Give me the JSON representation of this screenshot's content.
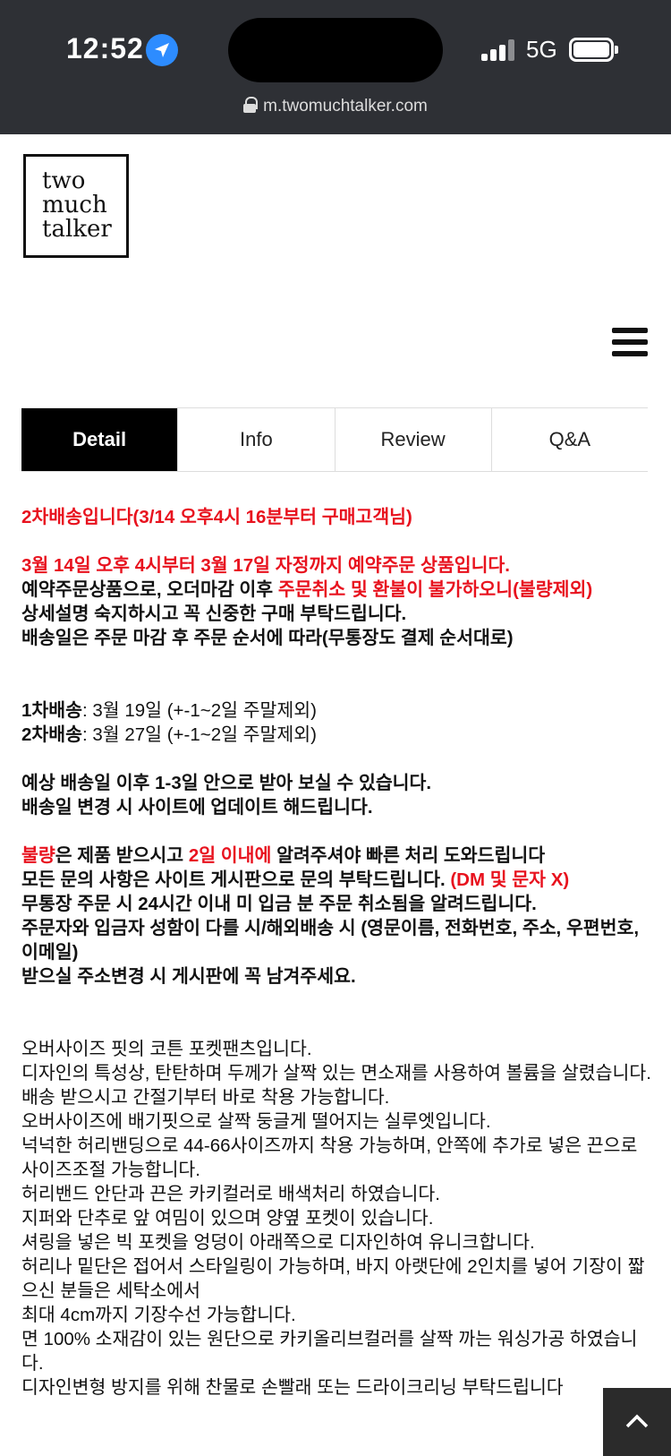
{
  "status_bar": {
    "time": "12:52",
    "network": "5G"
  },
  "browser": {
    "url": "m.twomuchtalker.com"
  },
  "logo": {
    "lines": [
      "two",
      "much",
      "talker"
    ]
  },
  "tabs": [
    {
      "label": "Detail",
      "active": true
    },
    {
      "label": "Info",
      "active": false
    },
    {
      "label": "Review",
      "active": false
    },
    {
      "label": "Q&A",
      "active": false
    }
  ],
  "notice": {
    "heading": "2차배송입니다(3/14 오후4시 16분부터 구매고객님)",
    "preorder_period": "3월 14일 오후 4시부터 3월 17일 자정까지 예약주문 상품입니다.",
    "cancel_prefix": "예약주문상품으로, 오더마감 이후 ",
    "cancel_red": "주문취소 및 환불이 불가하오니(불량제외)",
    "read_carefully": "상세설명 숙지하시고 꼭 신중한 구매 부탁드립니다.",
    "ship_order": "배송일은 주문 마감 후 주문 순서에 따라(무통장도 결제 순서대로)",
    "first_ship_label": "1차배송",
    "first_ship_value": ": 3월 19일 (+-1~2일 주말제외)",
    "second_ship_label": "2차배송",
    "second_ship_value": ": 3월 27일 (+-1~2일 주말제외)",
    "receive_window": "예상 배송일 이후 1-3일 안으로 받아 보실 수 있습니다.",
    "site_update": "배송일 변경 시 사이트에 업데이트 해드립니다.",
    "defect_red1": "불량",
    "defect_mid1": "은 제품 받으시고 ",
    "defect_red2": "2일 이내에",
    "defect_tail": " 알려주셔야 빠른 처리 도와드립니다",
    "inquiry_prefix": "모든 문의 사항은 사이트 게시판으로 문의 부탁드립니다. ",
    "inquiry_red": "(DM 및 문자 X)",
    "bank_cancel": "무통장 주문 시 24시간 이내 미 입금 분 주문 취소됨을 알려드립니다.",
    "overseas": "주문자와 입금자 성함이 다를 시/해외배송 시 (영문이름, 전화번호, 주소, 우편번호, 이메일)",
    "address_change": "받으실 주소변경 시 게시판에 꼭 남겨주세요."
  },
  "description": [
    "오버사이즈 핏의 코튼 포켓팬츠입니다.",
    "디자인의 특성상, 탄탄하며 두께가 살짝 있는 면소재를 사용하여 볼륨을 살렸습니다.",
    "배송 받으시고 간절기부터 바로 착용 가능합니다.",
    "오버사이즈에 배기핏으로 살짝 둥글게 떨어지는 실루엣입니다.",
    "넉넉한 허리밴딩으로 44-66사이즈까지 착용 가능하며, 안쪽에 추가로 넣은 끈으로 사이즈조절 가능합니다.",
    "허리밴드 안단과 끈은 카키컬러로 배색처리 하였습니다.",
    "지퍼와 단추로 앞 여밈이 있으며 양옆 포켓이 있습니다.",
    "셔링을 넣은 빅 포켓을 엉덩이 아래쪽으로 디자인하여 유니크합니다.",
    "허리나 밑단은 접어서 스타일링이 가능하며, 바지 아랫단에 2인치를 넣어 기장이 짧으신 분들은 세탁소에서",
    "최대 4cm까지 기장수선 가능합니다.",
    "면 100% 소재감이 있는  원단으로 카키올리브컬러를 살짝 까는 워싱가공 하였습니다.",
    "디자인변형 방지를 위해 찬물로 손빨래 또는 드라이크리닝 부탁드립니다"
  ],
  "colors": {
    "accent_red": "#e8121e",
    "topbar": "#2e3035",
    "tab_active": "#000000"
  },
  "icons": {
    "location": "location-arrow-icon",
    "menu": "hamburger-menu-icon",
    "scroll_top": "chevron-up-icon"
  }
}
